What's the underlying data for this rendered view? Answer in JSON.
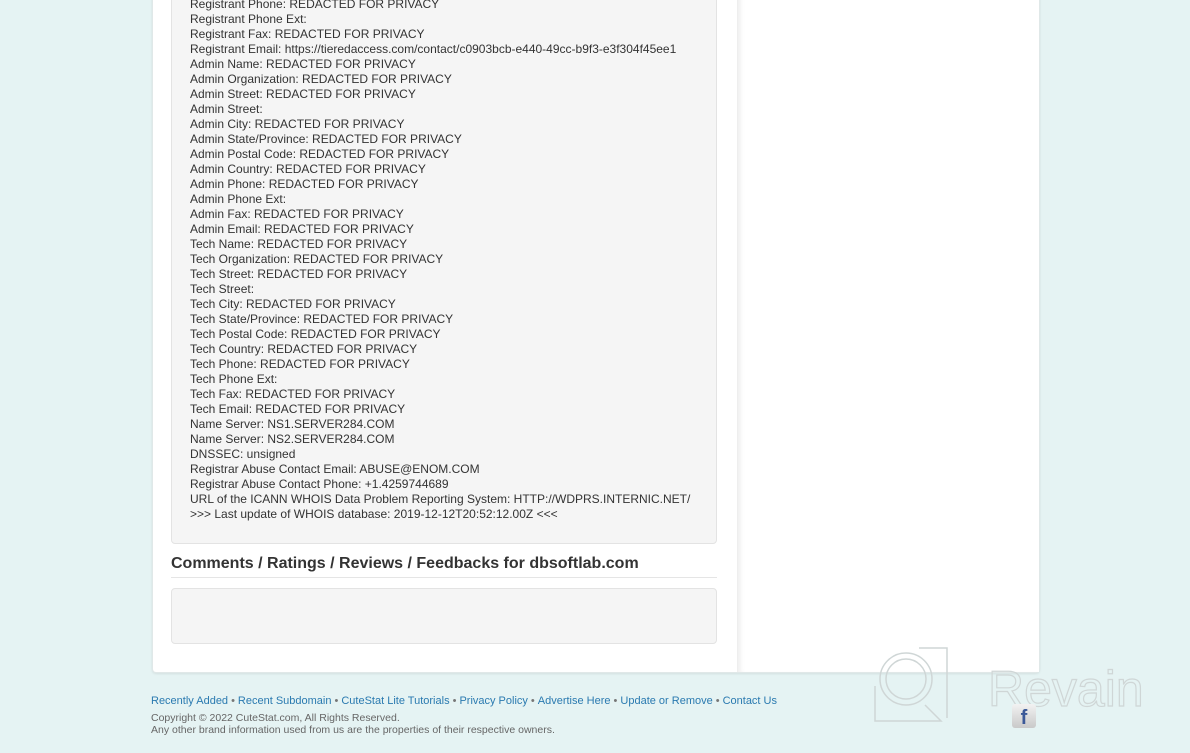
{
  "whois_lines": [
    "Registrant Phone: REDACTED FOR PRIVACY",
    "Registrant Phone Ext:",
    "Registrant Fax: REDACTED FOR PRIVACY",
    "Registrant Email: https://tieredaccess.com/contact/c0903bcb-e440-49cc-b9f3-e3f304f45ee1",
    "Admin Name: REDACTED FOR PRIVACY",
    "Admin Organization: REDACTED FOR PRIVACY",
    "Admin Street: REDACTED FOR PRIVACY",
    "Admin Street:",
    "Admin City: REDACTED FOR PRIVACY",
    "Admin State/Province: REDACTED FOR PRIVACY",
    "Admin Postal Code: REDACTED FOR PRIVACY",
    "Admin Country: REDACTED FOR PRIVACY",
    "Admin Phone: REDACTED FOR PRIVACY",
    "Admin Phone Ext:",
    "Admin Fax: REDACTED FOR PRIVACY",
    "Admin Email: REDACTED FOR PRIVACY",
    "Tech Name: REDACTED FOR PRIVACY",
    "Tech Organization: REDACTED FOR PRIVACY",
    "Tech Street: REDACTED FOR PRIVACY",
    "Tech Street:",
    "Tech City: REDACTED FOR PRIVACY",
    "Tech State/Province: REDACTED FOR PRIVACY",
    "Tech Postal Code: REDACTED FOR PRIVACY",
    "Tech Country: REDACTED FOR PRIVACY",
    "Tech Phone: REDACTED FOR PRIVACY",
    "Tech Phone Ext:",
    "Tech Fax: REDACTED FOR PRIVACY",
    "Tech Email: REDACTED FOR PRIVACY",
    "Name Server: NS1.SERVER284.COM",
    "Name Server: NS2.SERVER284.COM",
    "DNSSEC: unsigned",
    "Registrar Abuse Contact Email: ABUSE@ENOM.COM",
    "Registrar Abuse Contact Phone: +1.4259744689",
    "URL of the ICANN WHOIS Data Problem Reporting System: HTTP://WDPRS.INTERNIC.NET/",
    ">>> Last update of WHOIS database: 2019-12-12T20:52:12.00Z <<<"
  ],
  "comments": {
    "heading": "Comments / Ratings / Reviews / Feedbacks for dbsoftlab.com"
  },
  "footer": {
    "links": [
      "Recently Added",
      "Recent Subdomain",
      "CuteStat Lite Tutorials",
      "Privacy Policy",
      "Advertise Here",
      "Update or Remove",
      "Contact Us"
    ],
    "separator": "•",
    "copyright": "Copyright © 2022 CuteStat.com, All Rights Reserved.",
    "disclaimer": "Any other brand information used from us are the properties of their respective owners."
  },
  "watermark": {
    "text": "Revain"
  },
  "social": {
    "facebook_icon": "f"
  },
  "colors": {
    "link": "#2a7ab0",
    "background": "#e5f3f3"
  }
}
